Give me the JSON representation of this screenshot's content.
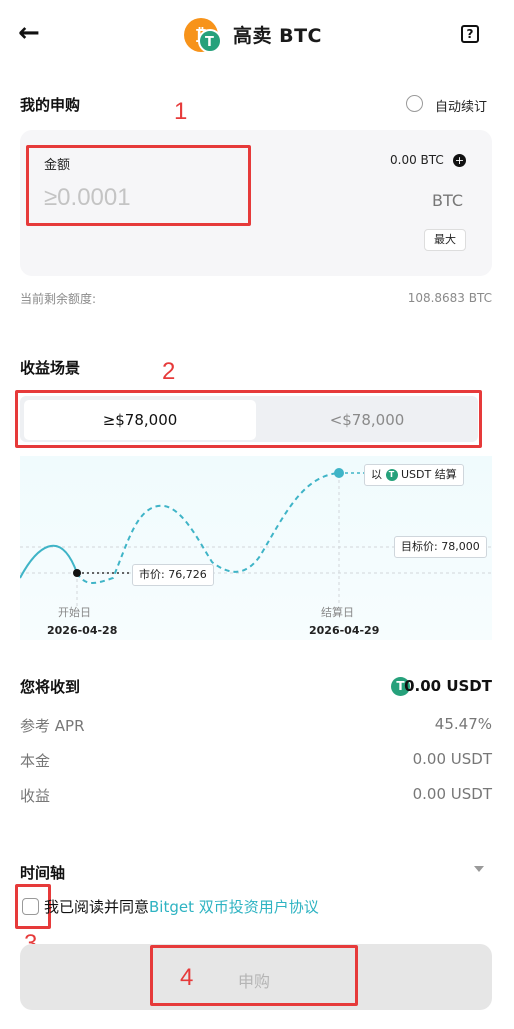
{
  "header": {
    "back_icon": "arrow-left-icon",
    "title": "高卖 BTC",
    "help_icon": "help-icon"
  },
  "subscription": {
    "section_title": "我的申购",
    "auto_renew_label": "自动续订",
    "amount_label": "金额",
    "balance": "0.00 BTC",
    "placeholder": "≥0.0001",
    "currency": "BTC",
    "max_label": "最大",
    "remaining_label": "当前剩余额度:",
    "remaining_value": "108.8683 BTC"
  },
  "annotations": [
    "1",
    "2",
    "3",
    "4"
  ],
  "scenario": {
    "section_title": "收益场景",
    "options": [
      "≥$78,000",
      "<$78,000"
    ],
    "selected": 0
  },
  "chart": {
    "settle_badge": "以",
    "settle_badge_token": "USDT 结算",
    "target_label": "目标价: 78,000",
    "market_label": "市价: 76,726",
    "start_label": "开始日",
    "start_date": "2026-04-28",
    "end_label": "结算日",
    "end_date": "2026-04-29"
  },
  "receive": {
    "title": "您将收到",
    "amount": "0.00 USDT",
    "rows": [
      {
        "label": "参考 APR",
        "value": "45.47%"
      },
      {
        "label": "本金",
        "value": "0.00 USDT"
      },
      {
        "label": "收益",
        "value": "0.00 USDT"
      }
    ]
  },
  "timeline": {
    "title": "时间轴"
  },
  "agreement": {
    "prefix": "我已阅读并同意",
    "link": "Bitget 双币投资用户协议"
  },
  "submit": {
    "label": "申购"
  },
  "colors": {
    "accent": "#2eb3c2",
    "annotation": "#e63a3a",
    "tether": "#26a17b",
    "coin": "#f7931a"
  }
}
